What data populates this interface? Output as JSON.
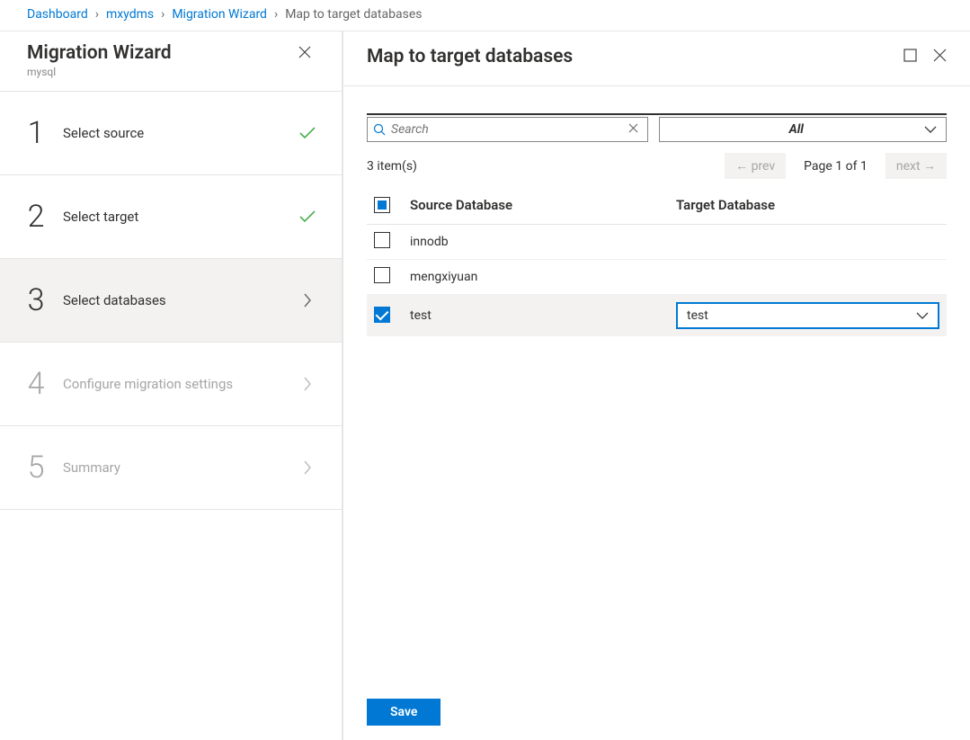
{
  "breadcrumb": {
    "items": [
      "Dashboard",
      "mxydms",
      "Migration Wizard"
    ],
    "current": "Map to target databases"
  },
  "sidebar": {
    "title": "Migration Wizard",
    "subtitle": "mysql",
    "steps": [
      {
        "num": "1",
        "label": "Select source",
        "state": "done"
      },
      {
        "num": "2",
        "label": "Select target",
        "state": "done"
      },
      {
        "num": "3",
        "label": "Select databases",
        "state": "active"
      },
      {
        "num": "4",
        "label": "Configure migration settings",
        "state": "disabled"
      },
      {
        "num": "5",
        "label": "Summary",
        "state": "disabled"
      }
    ]
  },
  "content": {
    "title": "Map to target databases",
    "search_placeholder": "Search",
    "filter_all": "All",
    "item_count": "3 item(s)",
    "pager": {
      "prev": "← prev",
      "label": "Page 1 of 1",
      "next": "next →"
    },
    "columns": {
      "source": "Source Database",
      "target": "Target Database"
    },
    "rows": [
      {
        "source": "innodb",
        "checked": false,
        "target": ""
      },
      {
        "source": "mengxiyuan",
        "checked": false,
        "target": ""
      },
      {
        "source": "test",
        "checked": true,
        "target": "test"
      }
    ],
    "save": "Save"
  }
}
